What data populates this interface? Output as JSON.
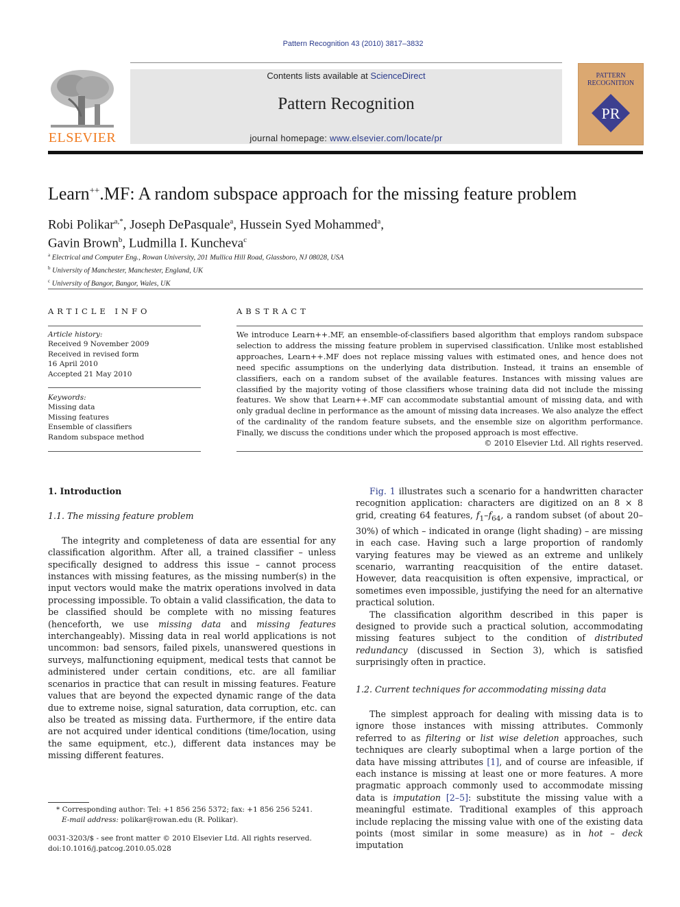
{
  "header": {
    "citation": "Pattern Recognition 43 (2010) 3817–3832",
    "contents_prefix": "Contents lists available at ",
    "contents_link": "ScienceDirect",
    "journal_name": "Pattern Recognition",
    "homepage_prefix": "journal homepage: ",
    "homepage_link": "www.elsevier.com/locate/pr",
    "publisher_logo_text": "ELSEVIER",
    "cover_title_line1": "PATTERN",
    "cover_title_line2": "RECOGNITION",
    "cover_emblem": "PR",
    "colors": {
      "link": "#2a3a8c",
      "elsevier_orange": "#f07a1e",
      "cover_bg": "#dba871",
      "cover_emblem": "#3d3f8f"
    }
  },
  "article": {
    "title_pre": "Learn",
    "title_sup": "++",
    "title_post": ".MF: A random subspace approach for the missing feature problem",
    "authors": [
      {
        "name": "Robi Polikar",
        "sup": "a,*"
      },
      {
        "name": "Joseph DePasquale",
        "sup": "a"
      },
      {
        "name": "Hussein Syed Mohammed",
        "sup": "a"
      },
      {
        "name": "Gavin Brown",
        "sup": "b"
      },
      {
        "name": "Ludmilla I. Kuncheva",
        "sup": "c"
      }
    ],
    "affiliations": [
      {
        "sup": "a",
        "text": "Electrical and Computer Eng., Rowan University, 201 Mullica Hill Road, Glassboro, NJ 08028, USA"
      },
      {
        "sup": "b",
        "text": "University of Manchester, Manchester, England, UK"
      },
      {
        "sup": "c",
        "text": "University of Bangor, Bangor, Wales, UK"
      }
    ]
  },
  "article_info": {
    "heading": "ARTICLE INFO",
    "history_label": "Article history:",
    "history": [
      "Received 9 November 2009",
      "Received in revised form",
      "16 April 2010",
      "Accepted 21 May 2010"
    ],
    "keywords_label": "Keywords:",
    "keywords": [
      "Missing data",
      "Missing features",
      "Ensemble of classifiers",
      "Random subspace method"
    ]
  },
  "abstract": {
    "heading": "ABSTRACT",
    "text": "We introduce Learn++.MF, an ensemble-of-classifiers based algorithm that employs random subspace selection to address the missing feature problem in supervised classification. Unlike most established approaches, Learn++.MF does not replace missing values with estimated ones, and hence does not need specific assumptions on the underlying data distribution. Instead, it trains an ensemble of classifiers, each on a random subset of the available features. Instances with missing values are classified by the majority voting of those classifiers whose training data did not include the missing features. We show that Learn++.MF can accommodate substantial amount of missing data, and with only gradual decline in performance as the amount of missing data increases. We also analyze the effect of the cardinality of the random feature subsets, and the ensemble size on algorithm performance. Finally, we discuss the conditions under which the proposed approach is most effective.",
    "copyright": "© 2010 Elsevier Ltd. All rights reserved."
  },
  "body": {
    "section1_heading": "1.  Introduction",
    "section11_heading": "1.1.  The missing feature problem",
    "para1_a": "The integrity and completeness of data are essential for any classification algorithm. After all, a trained classifier – unless specifically designed to address this issue – cannot process instances with missing features, as the missing number(s) in the input vectors would make the matrix operations involved in data processing impossible. To obtain a valid classification, the data to be classified should be complete with no missing features (henceforth, we use ",
    "para1_em1": "missing data",
    "para1_b": " and ",
    "para1_em2": "missing features",
    "para1_c": " interchangeably). Missing data in real world applications is not uncommon: bad sensors, failed pixels, unanswered questions in surveys, malfunctioning equipment, medical tests that cannot be administered under certain conditions, etc. are all familiar scenarios in practice that can result in missing features. Feature values that are beyond the expected dynamic range of the data due to extreme noise, signal saturation, data corruption, etc. can also be treated as missing data. Furthermore, if the entire data are not acquired under identical conditions (time/location, using the same equipment, etc.), different data instances may be missing different features.",
    "para2_link": "Fig. 1",
    "para2_a": " illustrates such a scenario for a handwritten character recognition application: characters are digitized on an 8 × 8 grid, creating 64 features, ",
    "para2_f1": "f",
    "para2_f1_sub": "1",
    "para2_dash": "–",
    "para2_f64": "f",
    "para2_f64_sub": "64",
    "para2_b": ", a random subset (of about 20–30%) of which – indicated in orange (light shading) – are missing in each case. Having such a large proportion of randomly varying features may be viewed as an extreme and unlikely scenario, warranting reacquisition of the entire dataset. However, data reacquisition is often expensive, impractical, or sometimes even impossible, justifying the need for an alternative practical solution.",
    "para3_a": "The classification algorithm described in this paper is designed to provide such a practical solution, accommodating missing features subject to the condition of ",
    "para3_em": "distributed redundancy",
    "para3_b": " (discussed in Section 3), which is satisfied surprisingly often in practice.",
    "section12_heading": "1.2.  Current techniques for accommodating missing data",
    "para4_a": "The simplest approach for dealing with missing data is to ignore those instances with missing attributes. Commonly referred to as ",
    "para4_em1": "filtering",
    "para4_b": " or ",
    "para4_em2": "list wise deletion",
    "para4_c": " approaches, such techniques are clearly suboptimal when a large portion of the data have missing attributes ",
    "para4_ref1": "[1]",
    "para4_d": ", and of course are infeasible, if each instance is missing at least one or more features. A more pragmatic approach commonly used to accommodate missing data is ",
    "para4_em3": "imputation",
    "para4_ref2": "[2–5]",
    "para4_e": ": substitute the missing value with a meaningful estimate. Traditional examples of this approach include replacing the missing value with one of the existing data points (most similar in some measure) as in ",
    "para4_em4": "hot – deck",
    "para4_f": " imputation"
  },
  "footnotes": {
    "corresponding": "Corresponding author: Tel: +1 856 256 5372; fax: +1 856 256 5241.",
    "email_label": "E-mail address:",
    "email": "polikar@rowan.edu (R. Polikar).",
    "issn": "0031-3203/$ - see front matter © 2010 Elsevier Ltd. All rights reserved.",
    "doi": "doi:10.1016/j.patcog.2010.05.028"
  }
}
